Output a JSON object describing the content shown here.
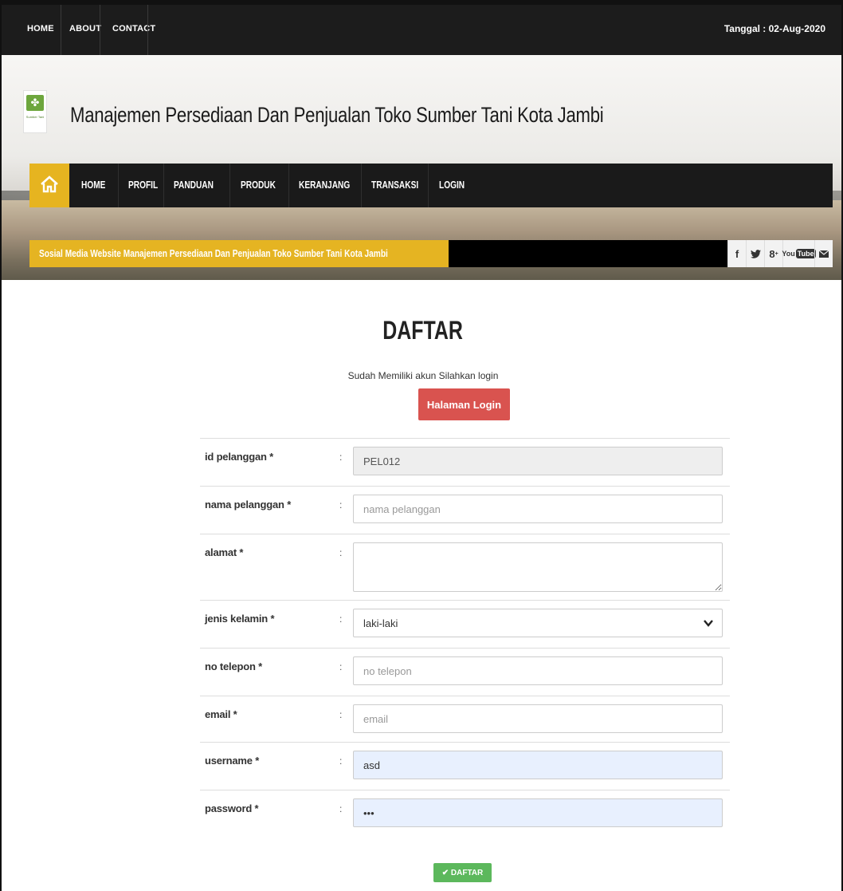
{
  "topbar": {
    "links": [
      "HOME",
      "ABOUT",
      "CONTACT"
    ],
    "date": "Tanggal : 02-Aug-2020"
  },
  "header": {
    "logo_text": "Sumber Tani",
    "site_title": "Manajemen Persediaan Dan Penjualan Toko Sumber Tani Kota Jambi"
  },
  "nav": {
    "items": [
      "HOME",
      "PROFIL",
      "PANDUAN",
      "PRODUK",
      "KERANJANG",
      "TRANSAKSI",
      "LOGIN"
    ]
  },
  "ticker": {
    "label": "Sosial Media Website Manajemen Persediaan Dan Penjualan Toko Sumber Tani Kota Jambi",
    "social": [
      "facebook-icon",
      "twitter-icon",
      "googleplus-icon",
      "youtube-icon",
      "mail-icon"
    ]
  },
  "main": {
    "title": "DAFTAR",
    "subtext": "Sudah Memiliki akun Silahkan login",
    "login_button": "Halaman Login"
  },
  "form": {
    "id_label": "id pelanggan *",
    "id_value": "PEL012",
    "nama_label": "nama pelanggan *",
    "nama_placeholder": "nama pelanggan",
    "alamat_label": "alamat *",
    "jk_label": "jenis kelamin *",
    "jk_value": "laki-laki",
    "telp_label": "no telepon *",
    "telp_placeholder": "no telepon",
    "email_label": "email *",
    "email_placeholder": "email",
    "username_label": "username *",
    "username_value": "asd",
    "password_label": "password *",
    "password_value": "•••",
    "colon": ":",
    "submit": "✔ DAFTAR"
  },
  "colors": {
    "accent": "#e6b420",
    "danger": "#d9534f",
    "success": "#5cb85c",
    "dark": "#1a1a1a"
  }
}
